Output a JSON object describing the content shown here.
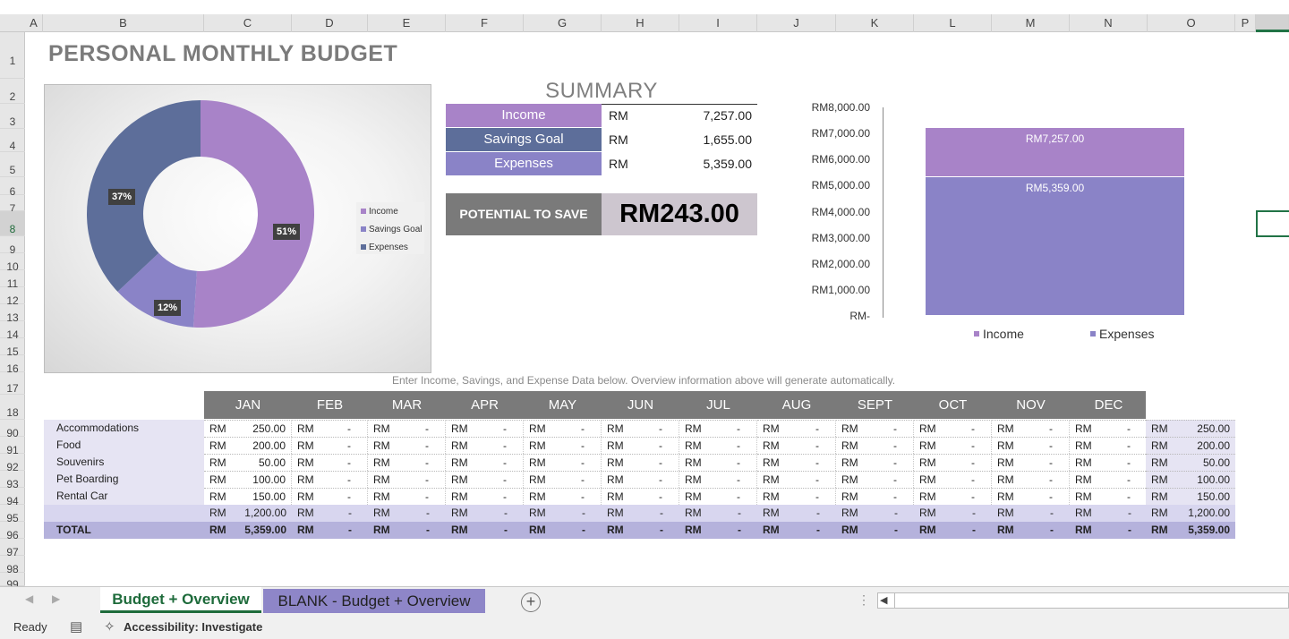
{
  "columns": [
    "A",
    "B",
    "C",
    "D",
    "E",
    "F",
    "G",
    "H",
    "I",
    "J",
    "K",
    "L",
    "M",
    "N",
    "O",
    "P"
  ],
  "rows": [
    "1",
    "2",
    "3",
    "4",
    "5",
    "6",
    "7",
    "8",
    "9",
    "10",
    "11",
    "12",
    "13",
    "14",
    "15",
    "16",
    "17",
    "18",
    "90",
    "91",
    "92",
    "93",
    "94",
    "95",
    "96",
    "97",
    "98",
    "99"
  ],
  "title": "PERSONAL MONTHLY BUDGET",
  "summary": {
    "title": "SUMMARY",
    "items": [
      {
        "label": "Income",
        "currency": "RM",
        "value": "7,257.00",
        "color": "#a883c8"
      },
      {
        "label": "Savings Goal",
        "currency": "RM",
        "value": "1,655.00",
        "color": "#5d6e9a"
      },
      {
        "label": "Expenses",
        "currency": "RM",
        "value": "5,359.00",
        "color": "#8a83c7"
      }
    ],
    "potential_label": "POTENTIAL TO SAVE",
    "potential_value": "RM243.00"
  },
  "chart_data": [
    {
      "type": "pie",
      "variant": "doughnut",
      "categories": [
        "Income",
        "Savings Goal",
        "Expenses"
      ],
      "values": [
        51,
        12,
        37
      ],
      "data_labels": [
        "51%",
        "12%",
        "37%"
      ],
      "colors": [
        "#a883c8",
        "#8a83c7",
        "#5d6e9a"
      ],
      "legend": "right"
    },
    {
      "type": "bar",
      "variant": "overlapping-column",
      "ytick_labels": [
        "RM8,000.00",
        "RM7,000.00",
        "RM6,000.00",
        "RM5,000.00",
        "RM4,000.00",
        "RM3,000.00",
        "RM2,000.00",
        "RM1,000.00",
        "RM-"
      ],
      "ylim": [
        0,
        8000
      ],
      "series": [
        {
          "name": "Income",
          "values": [
            7257
          ],
          "label": "RM7,257.00",
          "color": "#a883c8"
        },
        {
          "name": "Expenses",
          "values": [
            5359
          ],
          "label": "RM5,359.00",
          "color": "#8a83c7"
        }
      ],
      "legend": "bottom"
    }
  ],
  "note": "Enter Income, Savings, and Expense Data below. Overview information above will generate automatically.",
  "months": [
    "JAN",
    "FEB",
    "MAR",
    "APR",
    "MAY",
    "JUN",
    "JUL",
    "AUG",
    "SEPT",
    "OCT",
    "NOV",
    "DEC"
  ],
  "currency": "RM",
  "dash": "-",
  "expense_rows": [
    {
      "label": "Accommodations",
      "jan": "250.00",
      "total": "250.00"
    },
    {
      "label": "Food",
      "jan": "200.00",
      "total": "200.00"
    },
    {
      "label": "Souvenirs",
      "jan": "50.00",
      "total": "50.00"
    },
    {
      "label": "Pet Boarding",
      "jan": "100.00",
      "total": "100.00"
    },
    {
      "label": "Rental Car",
      "jan": "150.00",
      "total": "150.00"
    },
    {
      "label": "",
      "jan": "1,200.00",
      "total": "1,200.00"
    }
  ],
  "total_row": {
    "label": "TOTAL",
    "jan": "5,359.00",
    "total": "5,359.00"
  },
  "tabs": [
    "Budget + Overview",
    "BLANK - Budget + Overview"
  ],
  "add_tab": "+",
  "status": {
    "ready": "Ready",
    "accessibility": "Accessibility: Investigate"
  }
}
